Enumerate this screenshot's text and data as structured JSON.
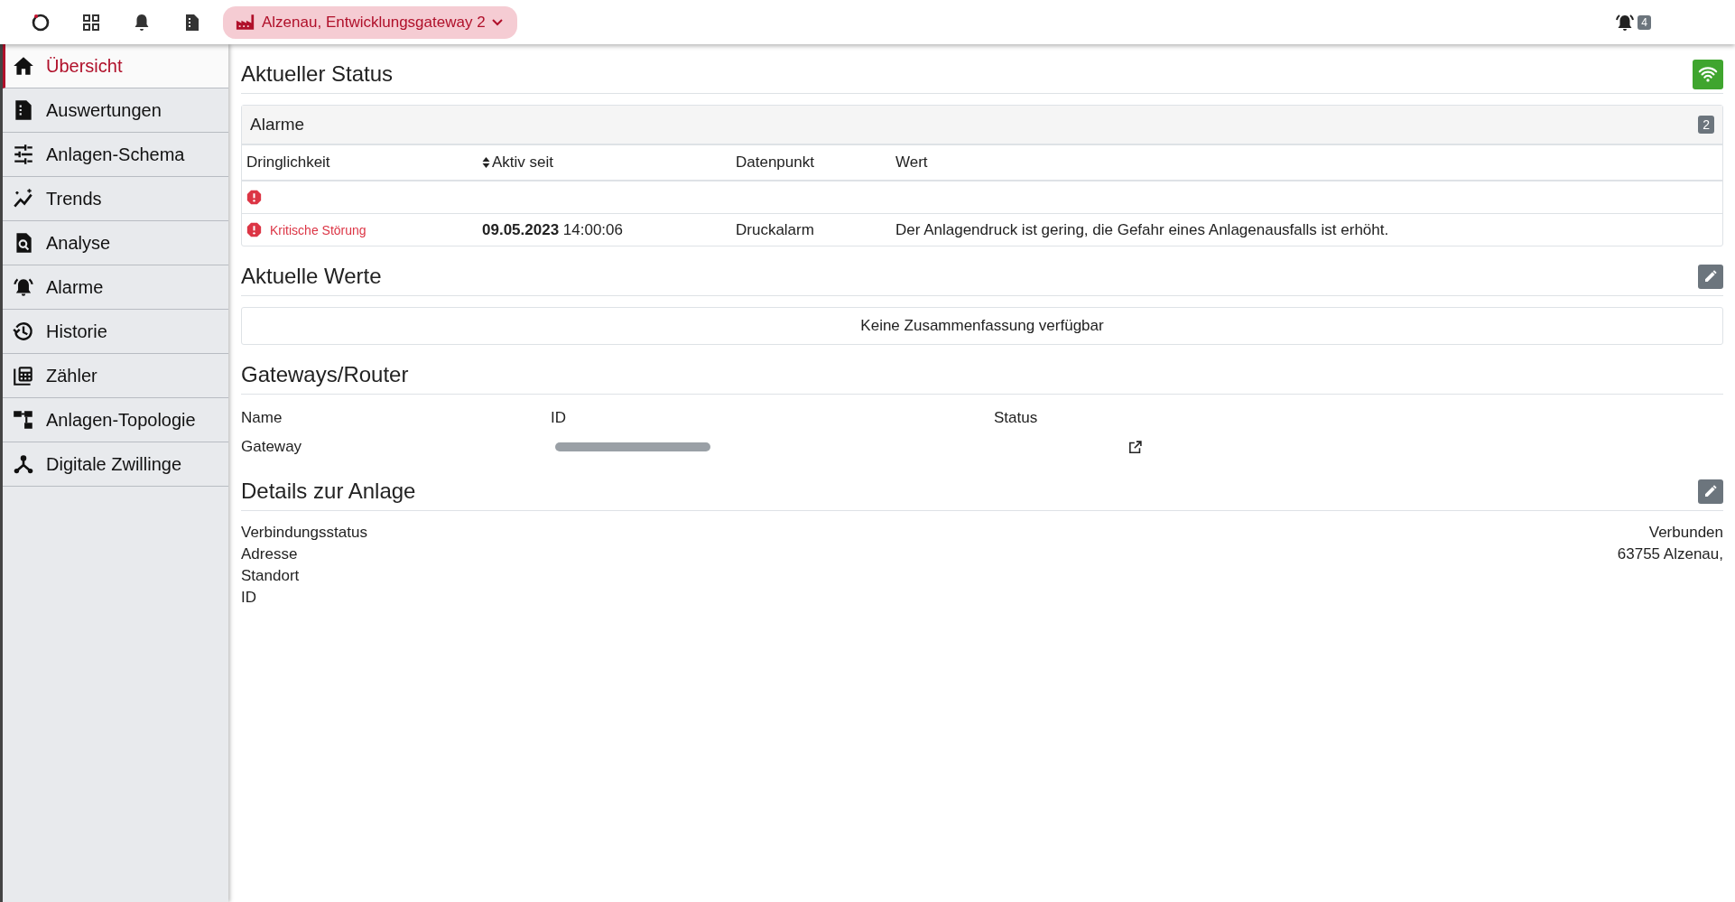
{
  "topbar": {
    "site": "Alzenau, Entwicklungsgateway 2",
    "alarm_count": "4"
  },
  "sidebar": {
    "items": [
      {
        "label": "Übersicht",
        "selected": true
      },
      {
        "label": "Auswertungen",
        "selected": false
      },
      {
        "label": "Anlagen-Schema",
        "selected": false
      },
      {
        "label": "Trends",
        "selected": false
      },
      {
        "label": "Analyse",
        "selected": false
      },
      {
        "label": "Alarme",
        "selected": false
      },
      {
        "label": "Historie",
        "selected": false
      },
      {
        "label": "Zähler",
        "selected": false
      },
      {
        "label": "Anlagen-Topologie",
        "selected": false
      },
      {
        "label": "Digitale Zwillinge",
        "selected": false
      }
    ]
  },
  "status": {
    "title": "Aktueller Status",
    "connected": true
  },
  "alarms": {
    "title": "Alarme",
    "count": "2",
    "columns": [
      "Dringlichkeit",
      "Aktiv seit",
      "Datenpunkt",
      "Wert"
    ],
    "rows": [
      {
        "kind": "critical"
      },
      {
        "kind": "critical",
        "severity": "Kritische Störung",
        "date": "09.05.2023",
        "time": "14:00:06",
        "datapoint": "Druckalarm",
        "value": "Der Anlagendruck ist gering, die Gefahr eines Anlagenausfalls ist erhöht."
      }
    ]
  },
  "values": {
    "title": "Aktuelle Werte",
    "empty": "Keine Zusammenfassung verfügbar"
  },
  "gateways": {
    "title": "Gateways/Router",
    "columns": [
      "Name",
      "ID",
      "Status"
    ],
    "rows": [
      {
        "name": "Gateway"
      }
    ]
  },
  "details": {
    "title": "Details zur Anlage",
    "rows": [
      {
        "label": "Verbindungsstatus",
        "value": "Verbunden"
      },
      {
        "label": "Adresse",
        "value": "63755 Alzenau,"
      },
      {
        "label": "Standort"
      },
      {
        "label": "ID"
      }
    ]
  }
}
